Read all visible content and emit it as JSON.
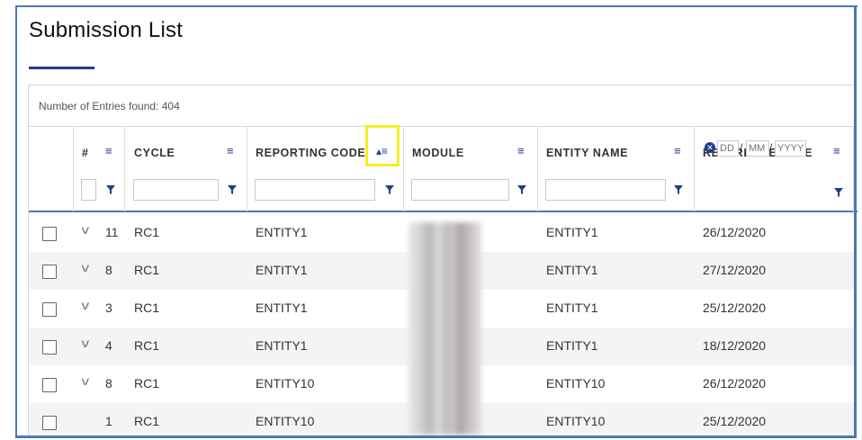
{
  "page_title": "Submission List",
  "entries_text": "Number of Entries found:  404",
  "columns": {
    "number": "#",
    "cycle": "CYCLE",
    "reporting_code": "REPORTING CODE",
    "module": "MODULE",
    "entity_name": "ENTITY NAME",
    "reference_date": "REFERENCE DATE"
  },
  "date_filter": {
    "day_placeholder": "DD",
    "month_placeholder": "MM",
    "year_placeholder": "YYYY"
  },
  "icons": {
    "column_menu": "menu-lines-icon",
    "filter": "funnel-icon",
    "sort_asc": "sort-ascending-icon",
    "clear": "clear-circle-icon",
    "expand": "chevron-down-icon"
  },
  "colors": {
    "accent": "#1f3d8a",
    "frame": "#4a78b8",
    "highlight": "#f4f01e"
  },
  "rows": [
    {
      "expandable": true,
      "num": "11",
      "cycle": "RC1",
      "reporting_code": "ENTITY1",
      "entity_name": "ENTITY1",
      "reference_date": "26/12/2020"
    },
    {
      "expandable": true,
      "num": "8",
      "cycle": "RC1",
      "reporting_code": "ENTITY1",
      "entity_name": "ENTITY1",
      "reference_date": "27/12/2020"
    },
    {
      "expandable": true,
      "num": "3",
      "cycle": "RC1",
      "reporting_code": "ENTITY1",
      "entity_name": "ENTITY1",
      "reference_date": "25/12/2020"
    },
    {
      "expandable": true,
      "num": "4",
      "cycle": "RC1",
      "reporting_code": "ENTITY1",
      "entity_name": "ENTITY1",
      "reference_date": "18/12/2020"
    },
    {
      "expandable": true,
      "num": "8",
      "cycle": "RC1",
      "reporting_code": "ENTITY10",
      "entity_name": "ENTITY10",
      "reference_date": "26/12/2020"
    },
    {
      "expandable": false,
      "num": "1",
      "cycle": "RC1",
      "reporting_code": "ENTITY10",
      "entity_name": "ENTITY10",
      "reference_date": "25/12/2020"
    }
  ]
}
